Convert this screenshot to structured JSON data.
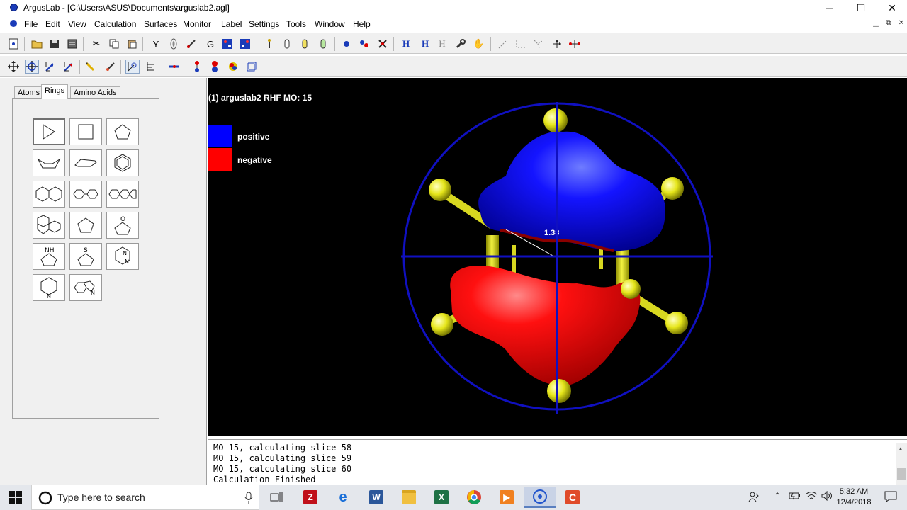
{
  "window": {
    "title": "ArgusLab - [C:\\Users\\ASUS\\Documents\\arguslab2.agl]",
    "controls": {
      "minimize": "─",
      "maximize": "☐",
      "close": "✕"
    }
  },
  "menu": {
    "items": [
      "File",
      "Edit",
      "View",
      "Calculation",
      "Surfaces",
      "Monitor",
      "Label",
      "Settings",
      "Tools",
      "Window",
      "Help"
    ]
  },
  "left_panel": {
    "tabs": [
      "Atoms",
      "Rings",
      "Amino Acids"
    ],
    "active_tab": "Rings",
    "ring_glyphs": {
      "nh": "NH",
      "s": "S",
      "o": "O",
      "n": "N"
    }
  },
  "viewport": {
    "title": "(1) arguslab2 RHF MO: 15",
    "legend": [
      {
        "label": "positive",
        "color": "#0000ff"
      },
      {
        "label": "negative",
        "color": "#ff0000"
      }
    ],
    "measurement": "1.38"
  },
  "output": {
    "lines": [
      "MO 15, calculating slice 58",
      "MO 15, calculating slice 59",
      "MO 15, calculating slice 60",
      "Calculation Finished"
    ]
  },
  "taskbar": {
    "search_placeholder": "Type here to search",
    "time": "5:32 AM",
    "date": "12/4/2018",
    "apps": [
      "task-view",
      "filezilla",
      "edge",
      "word",
      "file-explorer",
      "excel",
      "chrome",
      "media-player",
      "arguslab",
      "camtasia"
    ]
  },
  "colors": {
    "viewport_bg": "#000000",
    "positive_lobe": "#0000ff",
    "negative_lobe": "#ff0000",
    "atom_h": "#e6e61a",
    "trackball": "#1010c0"
  }
}
